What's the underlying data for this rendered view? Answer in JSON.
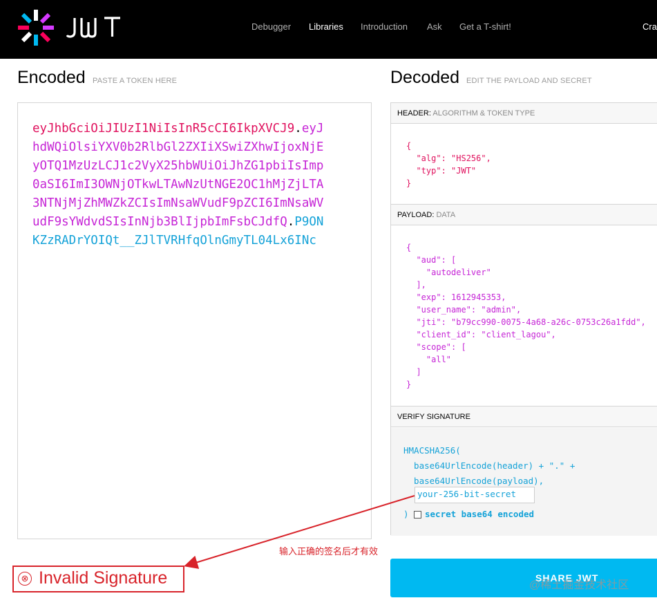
{
  "nav": {
    "logo_text": "JWT",
    "items": [
      "Debugger",
      "Libraries",
      "Introduction",
      "Ask",
      "Get a T-shirt!",
      "Cra"
    ]
  },
  "encoded": {
    "title": "Encoded",
    "subtitle": "PASTE A TOKEN HERE",
    "token_header": "eyJhbGciOiJIUzI1NiIsInR5cCI6IkpXVCJ9",
    "token_payload": "eyJhdWQiOlsiYXV0b2RlbGl2ZXIiXSwiZXhwIjoxNjEyOTQ1MzUzLCJ1c2VyX25hbWUiOiJhZG1pbiIsImp0aSI6ImI3OWNjOTkwLTAwNzUtNGE2OC1hMjZjLTA3NTNjMjZhMWZkZCIsImNsaWVudF9pZCI6ImNsaWVudF9sYWdvdSIsInNjb3BlIjpbImFsbCJdfQ",
    "token_signature": "P9ONKZzRADrYOIQt__ZJlTVRHfqOlnGmyTL04Lx6INc",
    "dot": "."
  },
  "decoded": {
    "title": "Decoded",
    "subtitle": "EDIT THE PAYLOAD AND SECRET",
    "header_label": "HEADER:",
    "header_sub": "ALGORITHM & TOKEN TYPE",
    "header_json": "{\n  \"alg\": \"HS256\",\n  \"typ\": \"JWT\"\n}",
    "payload_label": "PAYLOAD:",
    "payload_sub": "DATA",
    "payload_json": "{\n  \"aud\": [\n    \"autodeliver\"\n  ],\n  \"exp\": 1612945353,\n  \"user_name\": \"admin\",\n  \"jti\": \"b79cc990-0075-4a68-a26c-0753c26a1fdd\",\n  \"client_id\": \"client_lagou\",\n  \"scope\": [\n    \"all\"\n  ]\n}",
    "verify_label": "VERIFY SIGNATURE",
    "verify_line1": "HMACSHA256(",
    "verify_line2": "  base64UrlEncode(header) + \".\" +",
    "verify_line3": "  base64UrlEncode(payload),",
    "secret_value": "your-256-bit-secret",
    "close_paren": ")",
    "secret_b64_label": "secret base64 encoded",
    "secret_b64_checked": false
  },
  "status": {
    "invalid_icon": "⊗",
    "invalid_text": "Invalid Signature"
  },
  "share_button": "SHARE JWT",
  "annotation": "输入正确的签名后才有效",
  "watermark": "@稀土掘金技术社区",
  "colors": {
    "header": "#e0125e",
    "payload": "#c625d6",
    "signature": "#14a2d8",
    "invalid": "#d8232a",
    "share": "#00b9f1"
  }
}
